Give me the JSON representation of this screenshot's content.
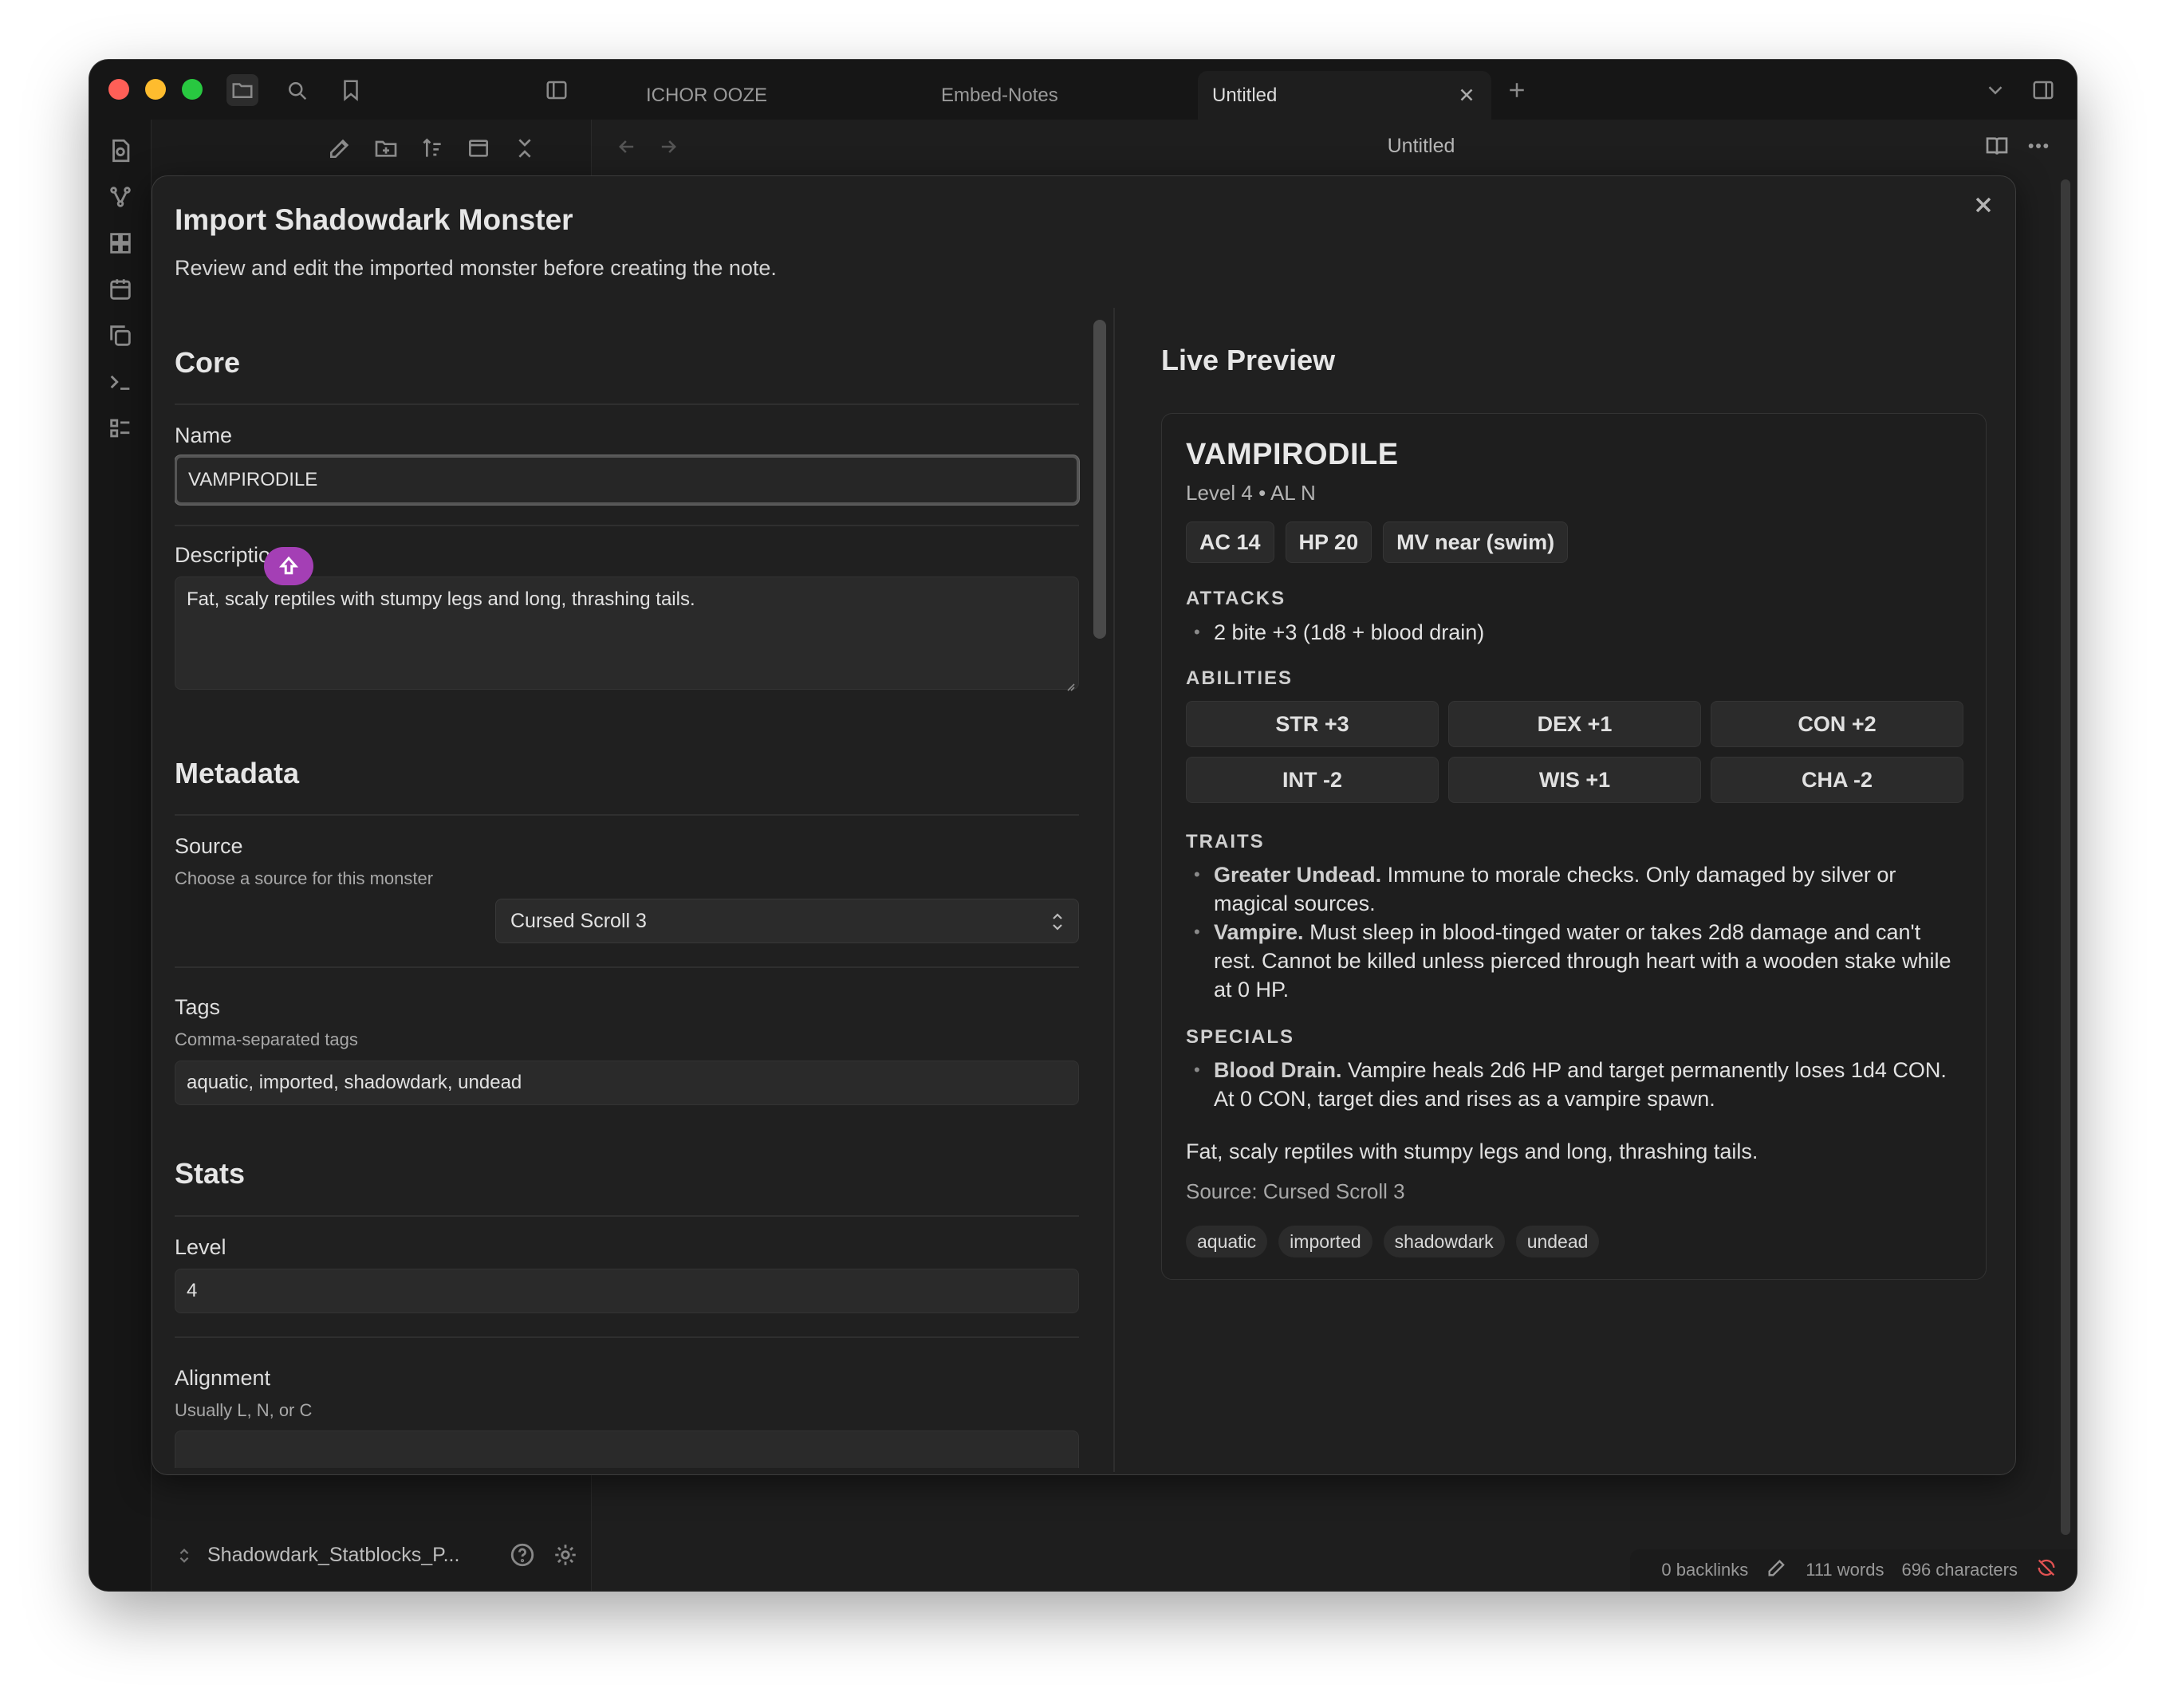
{
  "tabs": [
    {
      "label": "ICHOR OOZE"
    },
    {
      "label": "Embed-Notes"
    },
    {
      "label": "Untitled"
    }
  ],
  "view": {
    "title": "Untitled"
  },
  "vault": {
    "name": "Shadowdark_Statblocks_P..."
  },
  "status": {
    "backlinks": "0 backlinks",
    "words": "111 words",
    "characters": "696 characters"
  },
  "modal": {
    "title": "Import Shadowdark Monster",
    "subtitle": "Review and edit the imported monster before creating the note.",
    "form": {
      "core_heading": "Core",
      "name_label": "Name",
      "name_value": "VAMPIRODILE",
      "description_label": "Description",
      "description_value": "Fat, scaly reptiles with stumpy legs and long, thrashing tails.",
      "metadata_heading": "Metadata",
      "source_label": "Source",
      "source_hint": "Choose a source for this monster",
      "source_value": "Cursed Scroll 3",
      "tags_label": "Tags",
      "tags_hint": "Comma-separated tags",
      "tags_value": "aquatic, imported, shadowdark, undead",
      "stats_heading": "Stats",
      "level_label": "Level",
      "level_value": "4",
      "alignment_label": "Alignment",
      "alignment_hint": "Usually L, N, or C"
    },
    "preview": {
      "heading": "Live Preview",
      "name": "VAMPIRODILE",
      "subline": "Level 4 • AL N",
      "chips": [
        "AC 14",
        "HP 20",
        "MV near (swim)"
      ],
      "attacks_caption": "ATTACKS",
      "attacks": [
        "2 bite +3 (1d8 + blood drain)"
      ],
      "abilities_caption": "ABILITIES",
      "abilities": [
        "STR +3",
        "DEX +1",
        "CON +2",
        "INT -2",
        "WIS +1",
        "CHA -2"
      ],
      "traits_caption": "TRAITS",
      "traits": [
        {
          "name": "Greater Undead.",
          "text": " Immune to morale checks. Only damaged by silver or magical sources."
        },
        {
          "name": "Vampire.",
          "text": " Must sleep in blood-tinged water or takes 2d8 damage and can't rest. Cannot be killed unless pierced through heart with a wooden stake while at 0 HP."
        }
      ],
      "specials_caption": "SPECIALS",
      "specials": [
        {
          "name": "Blood Drain.",
          "text": " Vampire heals 2d6 HP and target permanently loses 1d4 CON. At 0 CON, target dies and rises as a vampire spawn."
        }
      ],
      "description": "Fat, scaly reptiles with stumpy legs and long, thrashing tails.",
      "source": "Source: Cursed Scroll 3",
      "tags": [
        "aquatic",
        "imported",
        "shadowdark",
        "undead"
      ]
    }
  }
}
